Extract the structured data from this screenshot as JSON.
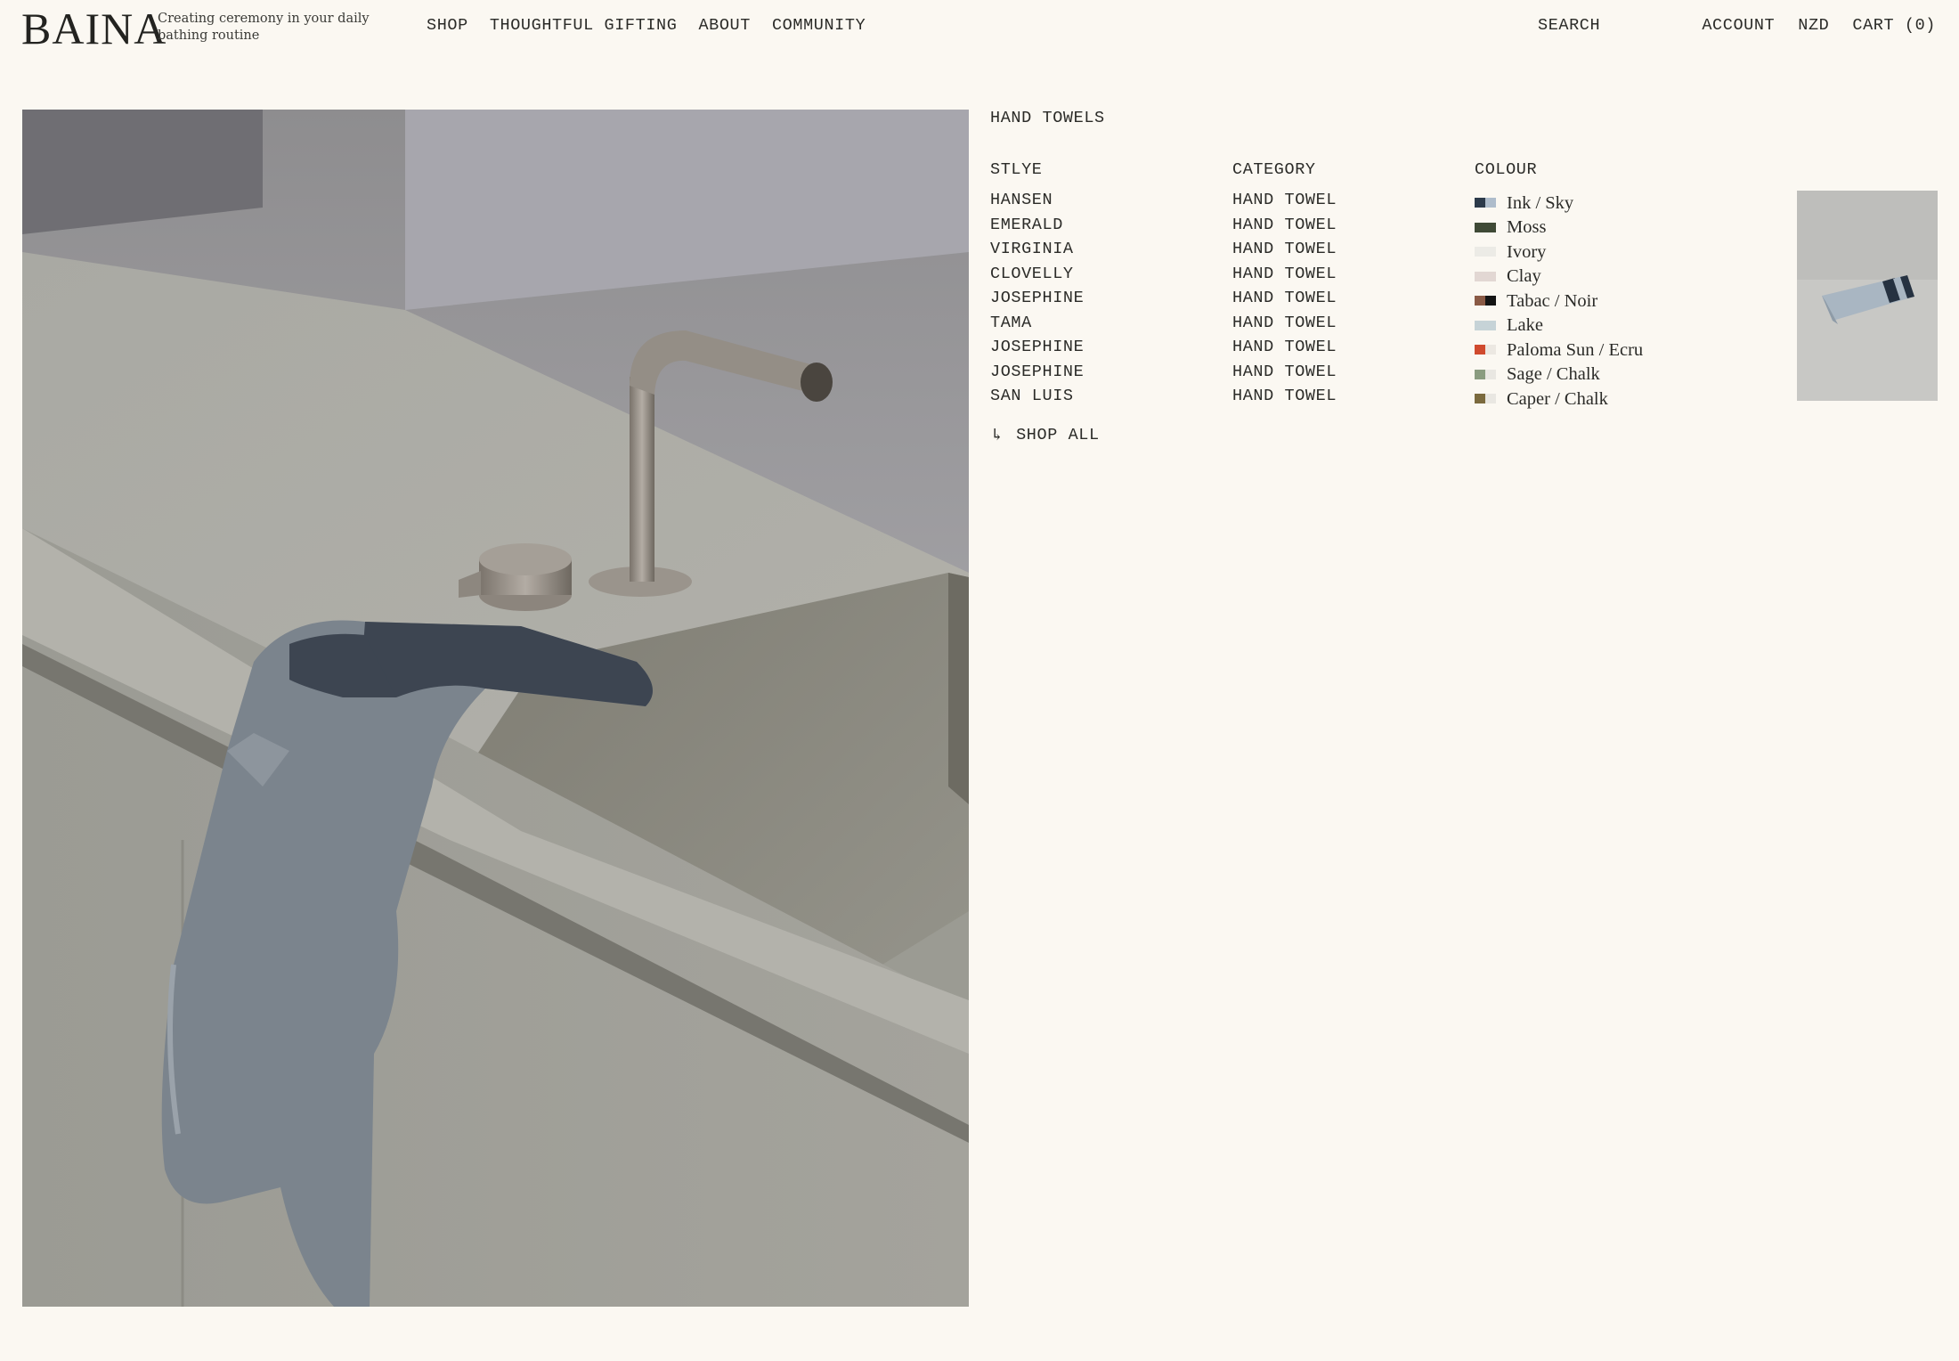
{
  "header": {
    "logo": "BAINA",
    "tagline": "Creating ceremony in your daily bathing routine",
    "nav": [
      "SHOP",
      "THOUGHTFUL GIFTING",
      "ABOUT",
      "COMMUNITY"
    ],
    "search": "SEARCH",
    "account": "ACCOUNT",
    "currency": "NZD",
    "cart": "CART (0)"
  },
  "menu": {
    "title": "HAND TOWELS",
    "headers": {
      "style": "STLYE",
      "category": "CATEGORY",
      "colour": "COLOUR"
    },
    "items": [
      {
        "style": "HANSEN",
        "category": "HAND TOWEL",
        "colour": "Ink / Sky",
        "swatch": [
          "#2c3a4a",
          "#aebccb"
        ]
      },
      {
        "style": "EMERALD",
        "category": "HAND TOWEL",
        "colour": "Moss",
        "swatch": [
          "#3f4a36",
          "#3f4a36"
        ]
      },
      {
        "style": "VIRGINIA",
        "category": "HAND TOWEL",
        "colour": "Ivory",
        "swatch": [
          "#ecebe6",
          "#ecebe6"
        ]
      },
      {
        "style": "CLOVELLY",
        "category": "HAND TOWEL",
        "colour": "Clay",
        "swatch": [
          "#e2d7d3",
          "#e2d7d3"
        ]
      },
      {
        "style": "JOSEPHINE",
        "category": "HAND TOWEL",
        "colour": "Tabac / Noir",
        "swatch": [
          "#8a5a45",
          "#141414"
        ]
      },
      {
        "style": "TAMA",
        "category": "HAND TOWEL",
        "colour": "Lake",
        "swatch": [
          "#c6d3d7",
          "#c6d3d7"
        ]
      },
      {
        "style": "JOSEPHINE",
        "category": "HAND TOWEL",
        "colour": "Paloma Sun / Ecru",
        "swatch": [
          "#d04a2e",
          "#ece8e2"
        ]
      },
      {
        "style": "JOSEPHINE",
        "category": "HAND TOWEL",
        "colour": "Sage / Chalk",
        "swatch": [
          "#8a9c80",
          "#e9e7e2"
        ]
      },
      {
        "style": "SAN LUIS",
        "category": "HAND TOWEL",
        "colour": "Caper / Chalk",
        "swatch": [
          "#7b6a3e",
          "#e9e7e2"
        ]
      }
    ],
    "shop_all": "SHOP ALL"
  },
  "images": {
    "hero": "hand-towel-draped-on-stone-basin",
    "thumbnail": "folded-hand-towel-ink-sky"
  },
  "icons": {
    "shop_all": "arrow-down-right-icon"
  }
}
